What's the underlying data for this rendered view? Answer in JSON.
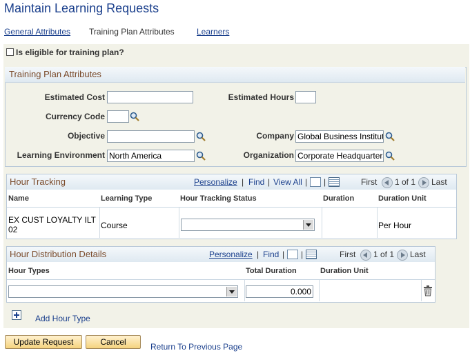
{
  "page": {
    "title": "Maintain Learning Requests"
  },
  "tabs": [
    {
      "label": "General Attributes"
    },
    {
      "label": "Training Plan Attributes"
    },
    {
      "label": "Learners"
    }
  ],
  "eligible": {
    "label": "Is eligible for training plan?"
  },
  "training_plan": {
    "heading": "Training Plan Attributes",
    "estimated_cost_label": "Estimated Cost",
    "estimated_cost": "",
    "estimated_hours_label": "Estimated Hours",
    "estimated_hours": "",
    "currency_code_label": "Currency Code",
    "currency_code": "",
    "objective_label": "Objective",
    "objective": "",
    "company_label": "Company",
    "company": "Global Business Institute",
    "learning_env_label": "Learning Environment",
    "learning_env": "North America",
    "organization_label": "Organization",
    "organization": "Corporate Headquarters"
  },
  "hour_tracking": {
    "title": "Hour Tracking",
    "personalize": "Personalize",
    "find": "Find",
    "view_all": "View All",
    "first": "First",
    "range": "1 of 1",
    "last": "Last",
    "columns": [
      "Name",
      "Learning Type",
      "Hour Tracking Status",
      "Duration",
      "Duration Unit"
    ],
    "rows": [
      {
        "name_line1": "EX CUST LOYALTY ILT",
        "name_line2": "02",
        "type": "Course",
        "status": "",
        "duration": "",
        "unit": "Per Hour"
      }
    ]
  },
  "hour_distribution": {
    "title": "Hour Distribution Details",
    "personalize": "Personalize",
    "find": "Find",
    "first": "First",
    "range": "1 of 1",
    "last": "Last",
    "columns": [
      "Hour Types",
      "Total Duration",
      "Duration Unit"
    ],
    "rows": [
      {
        "hour_type": "",
        "total_duration": "0.000",
        "unit": ""
      }
    ],
    "add_label": "Add Hour Type"
  },
  "footer": {
    "update": "Update Request",
    "cancel": "Cancel",
    "return": "Return To Previous Page"
  }
}
